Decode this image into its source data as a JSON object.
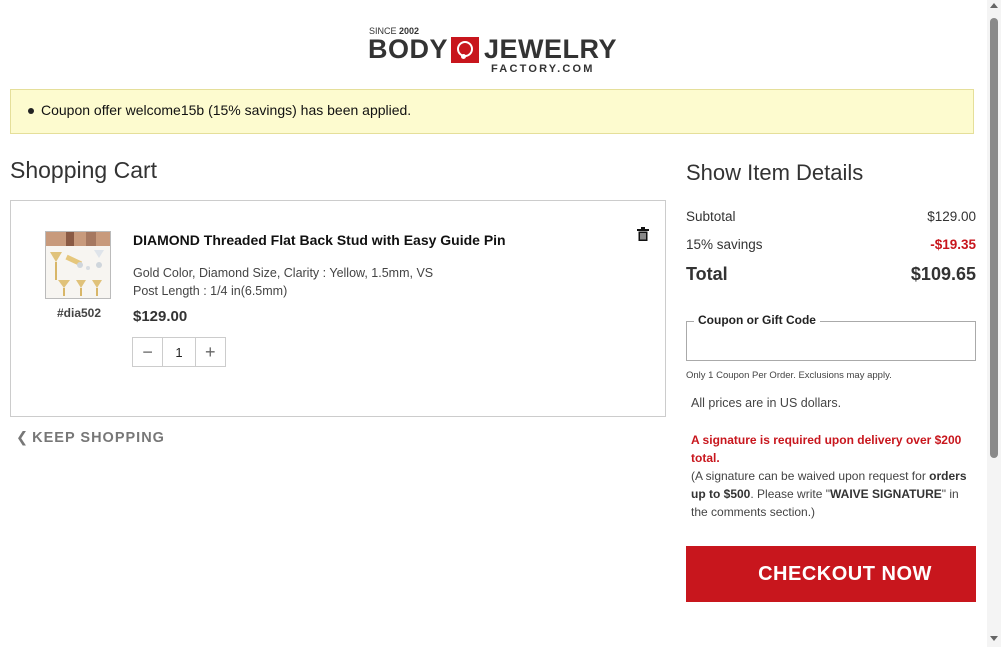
{
  "logo": {
    "since_label": "SINCE",
    "since_year": "2002",
    "brand_left": "BODY",
    "brand_right": "JEWELRY",
    "brand_sub": "FACTORY.COM",
    "brand_color": "#c8161d"
  },
  "notice": {
    "message": "Coupon offer welcome15b (15% savings) has been applied."
  },
  "cart": {
    "title": "Shopping Cart",
    "items": [
      {
        "name": "DIAMOND Threaded Flat Back Stud with Easy Guide Pin",
        "sku": "#dia502",
        "options": "Gold Color, Diamond Size, Clarity : Yellow, 1.5mm, VS",
        "post_length": "Post Length : 1/4 in(6.5mm)",
        "price": "$129.00",
        "quantity": "1",
        "remove_icon": "trash-icon"
      }
    ],
    "keep_shopping": "KEEP SHOPPING"
  },
  "summary": {
    "title": "Show Item Details",
    "subtotal_label": "Subtotal",
    "subtotal_value": "$129.00",
    "savings_label": "15% savings",
    "savings_value": "-$19.35",
    "total_label": "Total",
    "total_value": "$109.65",
    "coupon_label": "Coupon or Gift Code",
    "coupon_value": "",
    "coupon_note": "Only 1 Coupon Per Order. Exclusions may apply.",
    "currency_note": "All prices are in US dollars.",
    "signature_warning": "A signature is required upon delivery over $200 total.",
    "signature_p1": "(A signature can be waived upon request for ",
    "signature_b1": "orders up to $500",
    "signature_p2": ". Please write \"",
    "signature_b2": "WAIVE SIGNATURE",
    "signature_p3": "\" in the comments section.)",
    "checkout_label": "CHECKOUT NOW"
  },
  "colors": {
    "accent": "#c8161d",
    "notice_bg": "#fdfbcf"
  }
}
